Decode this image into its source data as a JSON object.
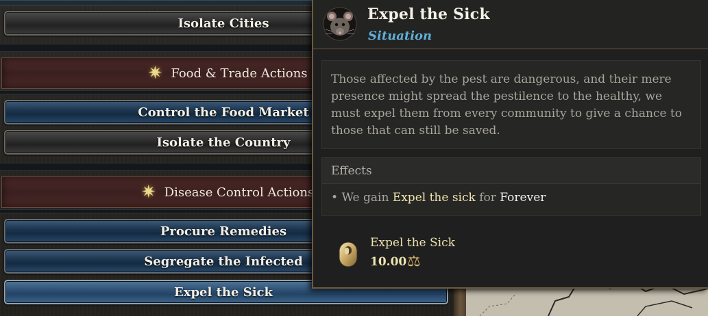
{
  "actions": {
    "isolate_cities": "Isolate Cities",
    "food_trade_header": "Food & Trade Actions",
    "control_food_market": "Control the Food Market",
    "isolate_country": "Isolate the Country",
    "disease_control_header": "Disease Control Actions",
    "procure_remedies": "Procure Remedies",
    "segregate_infected": "Segregate the Infected",
    "expel_sick": "Expel the Sick"
  },
  "tooltip": {
    "title": "Expel the Sick",
    "subtitle": "Situation",
    "description": "Those affected by the pest are dangerous, and their mere presence might spread the pestilence to the healthy, we must expel them from every community to give a chance to those that can still be saved.",
    "effects_header": "Effects",
    "effect_bullet": "•",
    "effect_prefix": "We gain",
    "effect_name": "Expel the sick",
    "effect_for": "for",
    "effect_duration": "Forever",
    "modifier_name": "Expel the Sick",
    "modifier_value": "10.00"
  },
  "icons": {
    "category": "star-icon",
    "situation": "rat-icon",
    "modifier": "capsule-icon",
    "scale": "scale-icon"
  },
  "colors": {
    "subtitle": "#5fb0d9",
    "highlight": "#efe3b0",
    "button_blue": "#1d3650",
    "category_red": "#3b2020"
  }
}
